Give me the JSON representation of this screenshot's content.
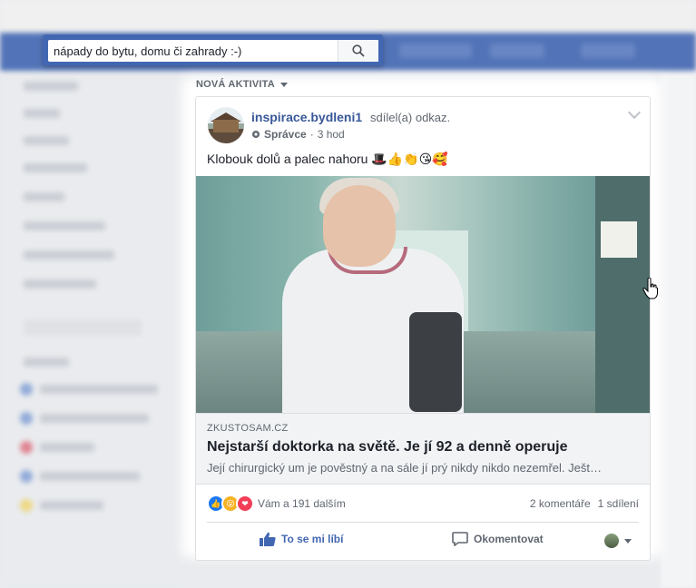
{
  "search": {
    "value": "nápady do bytu, domu či zahrady :-)"
  },
  "feed": {
    "label": "NOVÁ AKTIVITA"
  },
  "post": {
    "page_name": "inspirace.bydleni1",
    "action": "sdílel(a) odkaz.",
    "role": "Správce",
    "time": "3 hod",
    "text": "Klobouk dolů a palec nahoru 🎩👍👏😘🥰",
    "link": {
      "domain": "ZKUSTOSAM.CZ",
      "title": "Nejstarší doktorka na světě. Je jí 92 a denně operuje",
      "description": "Její chirurgický um je pověstný a na sále jí prý nikdy nikdo nezemřel. Ješt…"
    },
    "reactions_text": "Vám a 191 dalším",
    "comments": "2 komentáře",
    "shares": "1 sdílení",
    "actions": {
      "like": "To se mi líbí",
      "comment": "Okomentovat"
    }
  },
  "colors": {
    "brand": "#4267b2",
    "link": "#385898",
    "text": "#1d2129",
    "muted": "#606770"
  }
}
